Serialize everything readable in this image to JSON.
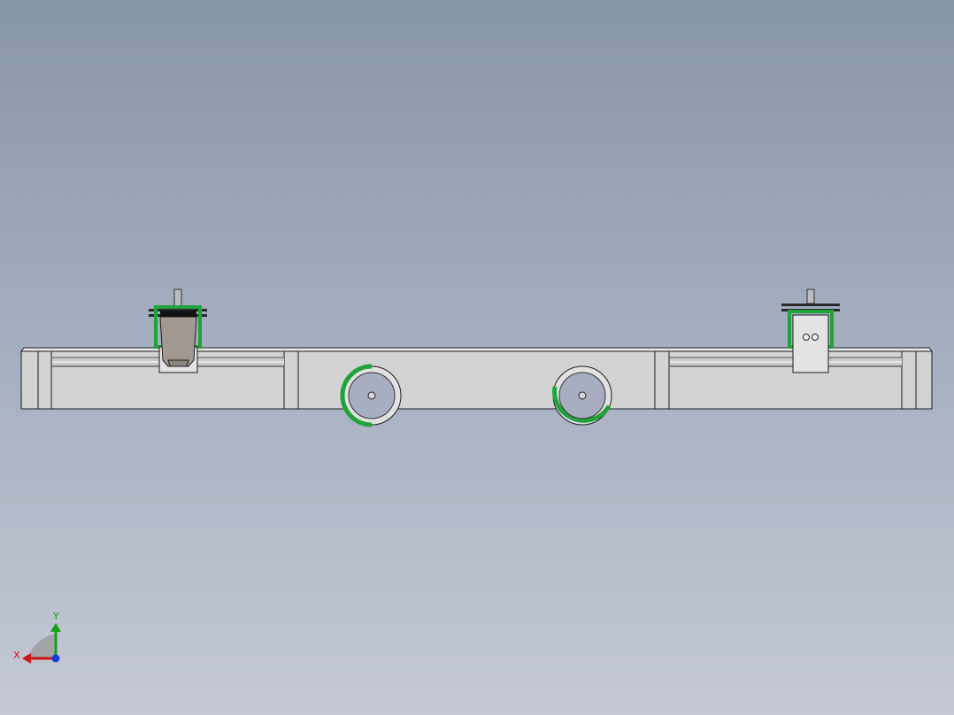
{
  "viewport": {
    "background_top": "#8795aa",
    "background_bottom": "#c4c9d4"
  },
  "model": {
    "frame_color": "#d3d3d3",
    "edge_color": "#1e1e1e",
    "accent_color": "#1fa33a",
    "hub_color": "#a9adc2",
    "block_color": "#a29a92"
  },
  "triad": {
    "x_label": "X",
    "y_label": "Y",
    "x_color": "#d01414",
    "y_color": "#14a014",
    "z_color": "#1a3cd8"
  }
}
